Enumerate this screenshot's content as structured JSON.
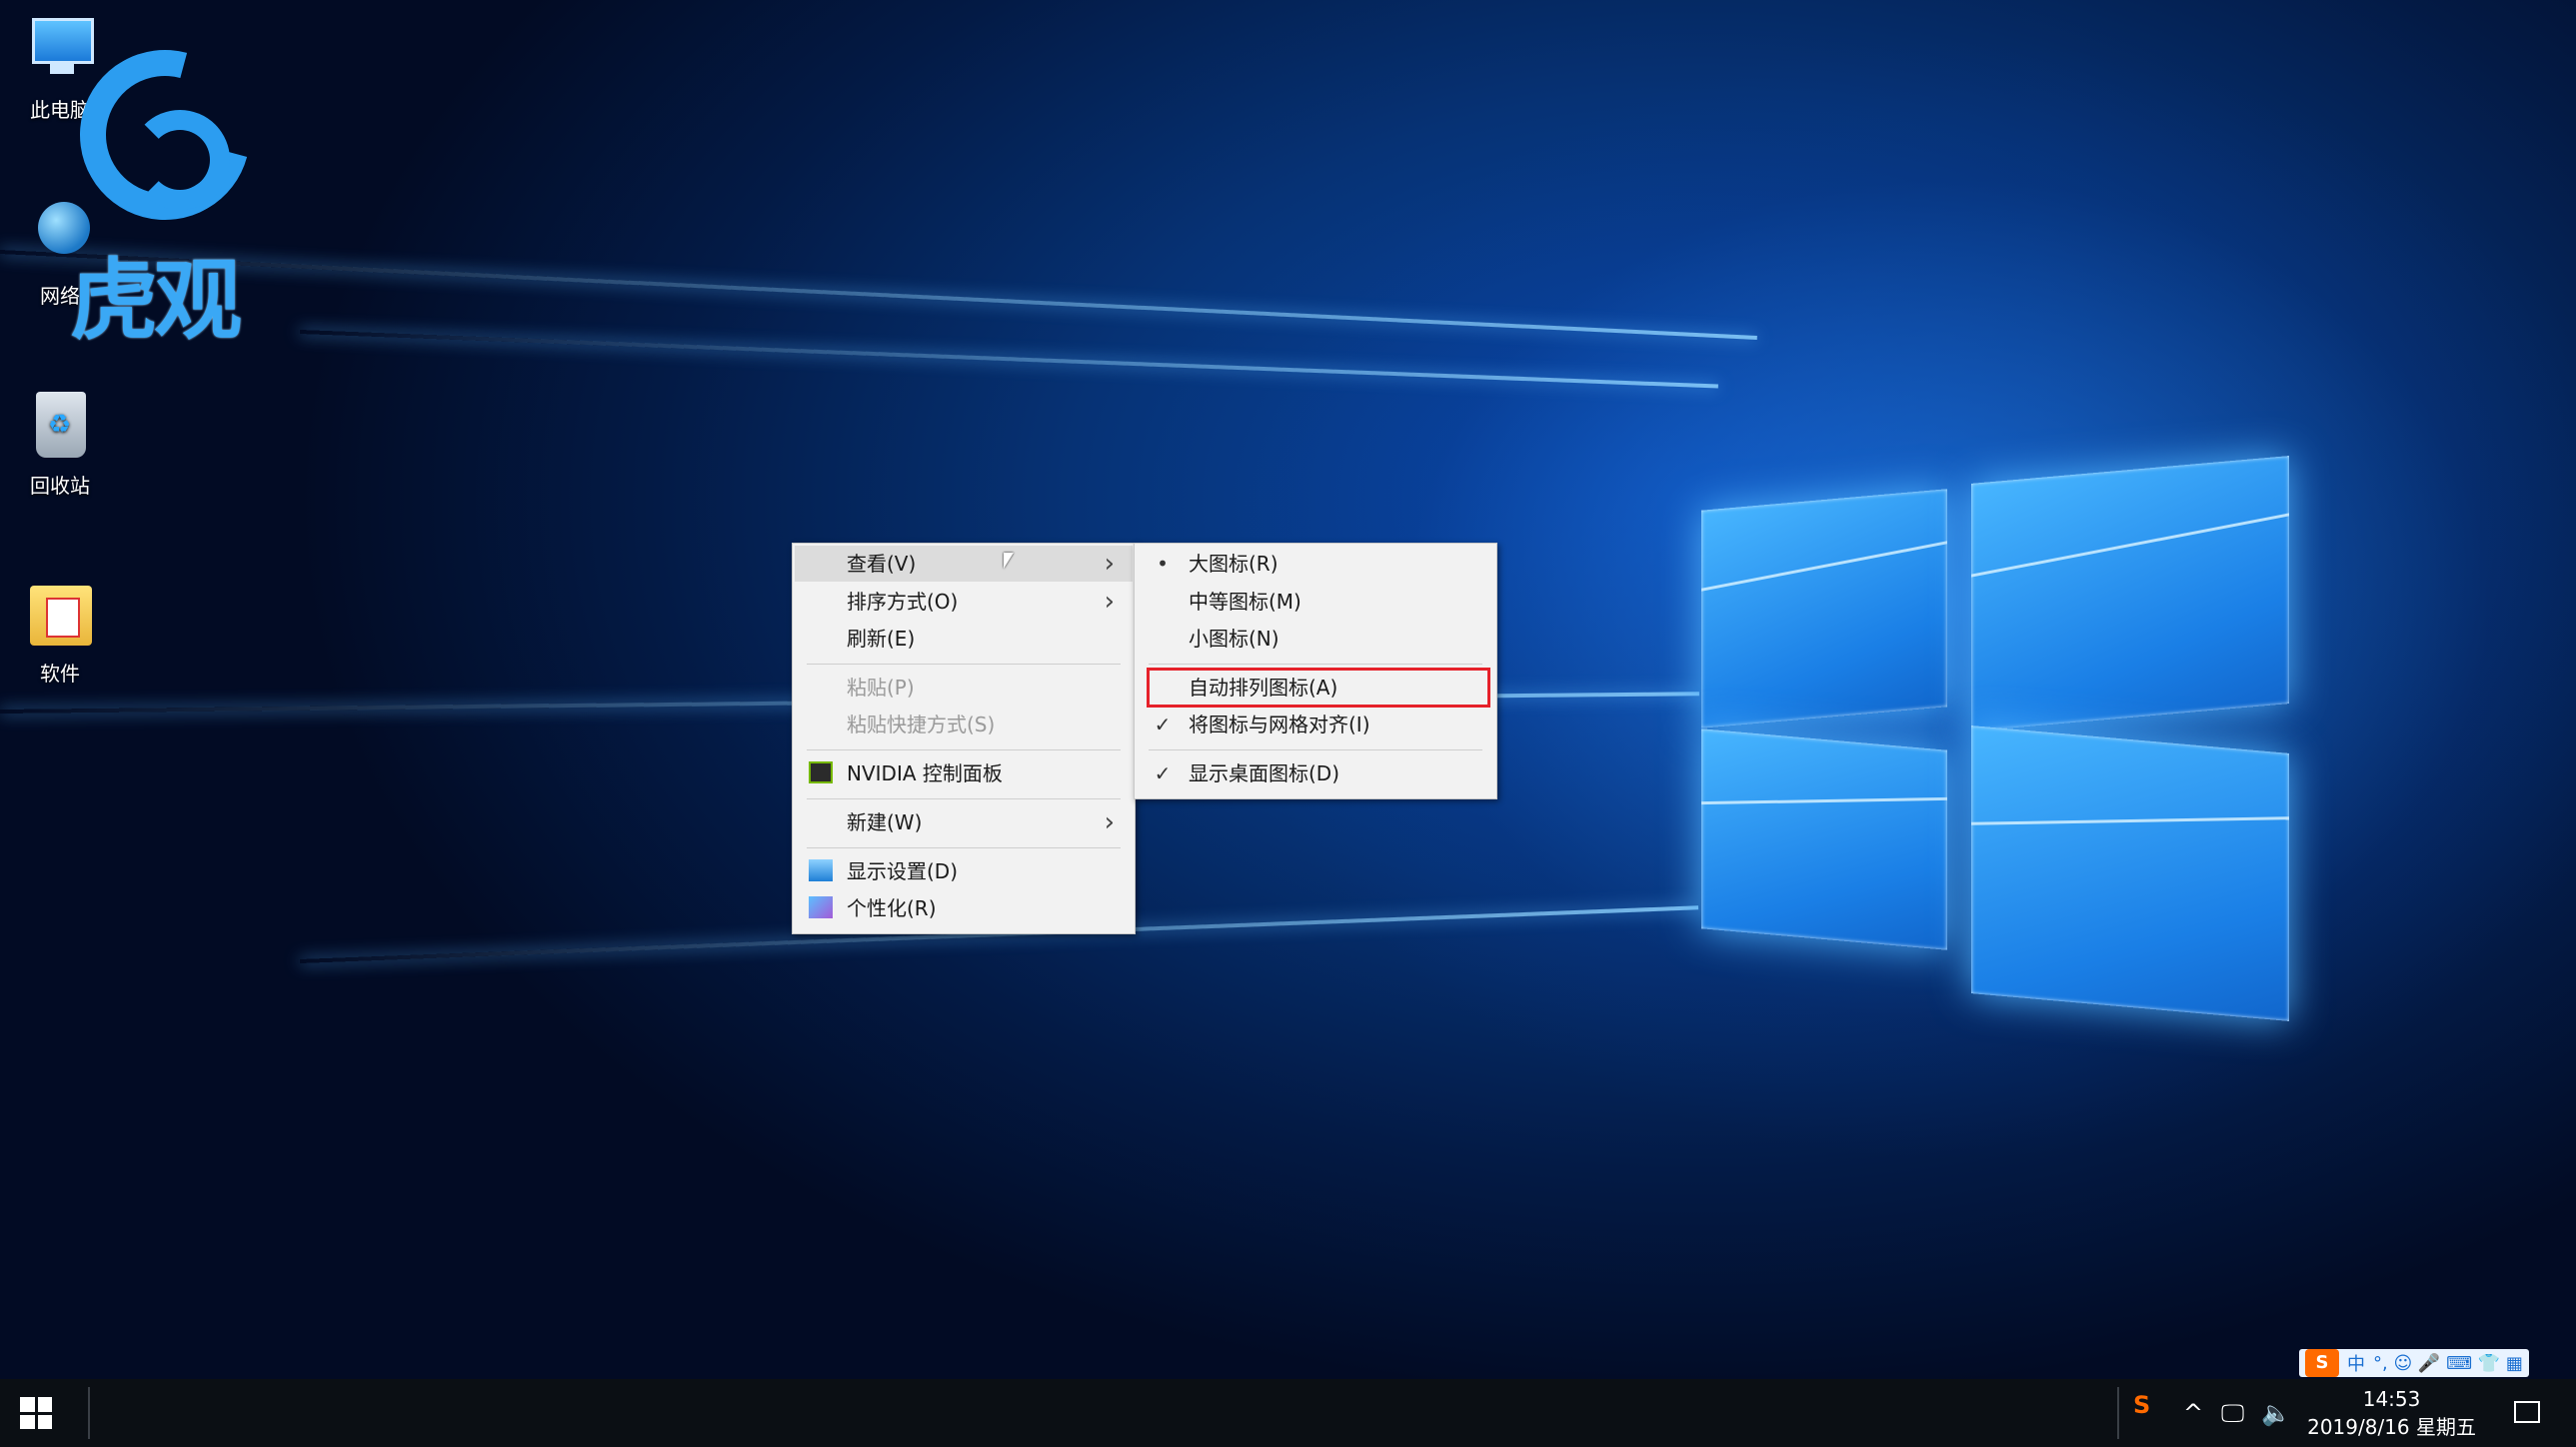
{
  "desktop": {
    "icons": [
      {
        "label": "此电脑",
        "icon": "computer-icon"
      },
      {
        "label": "网络",
        "icon": "network-icon"
      },
      {
        "label": "回收站",
        "icon": "recycle-bin-icon"
      },
      {
        "label": "软件",
        "icon": "folder-icon"
      }
    ],
    "watermark": {
      "text": "虎观",
      "icon": "huguan-logo"
    }
  },
  "context_menu": {
    "items": [
      {
        "label": "查看(V)",
        "has_submenu": true,
        "highlighted": true
      },
      {
        "label": "排序方式(O)",
        "has_submenu": true
      },
      {
        "label": "刷新(E)"
      },
      {
        "label": "粘贴(P)",
        "disabled": true
      },
      {
        "label": "粘贴快捷方式(S)",
        "disabled": true
      },
      {
        "label": "NVIDIA 控制面板",
        "icon": "nvidia-icon"
      },
      {
        "label": "新建(W)",
        "has_submenu": true
      },
      {
        "label": "显示设置(D)",
        "icon": "display-settings-icon"
      },
      {
        "label": "个性化(R)",
        "icon": "personalize-icon"
      }
    ]
  },
  "view_submenu": {
    "items": [
      {
        "label": "大图标(R)",
        "mark": "•"
      },
      {
        "label": "中等图标(M)",
        "mark": ""
      },
      {
        "label": "小图标(N)",
        "mark": ""
      },
      {
        "label": "自动排列图标(A)",
        "mark": "",
        "outlined": true
      },
      {
        "label": "将图标与网格对齐(I)",
        "mark": "✓"
      },
      {
        "label": "显示桌面图标(D)",
        "mark": "✓"
      }
    ],
    "outline_color": "#e6212a"
  },
  "taskbar": {
    "clock_time": "14:53",
    "clock_date": "2019/8/16 星期五",
    "ime": {
      "logo": "S",
      "mode": "中",
      "extras": "°, ☺ 🎤 ⌨ 👕 ▦"
    },
    "tray_icons": [
      "sogou-icon",
      "chevron-up-icon",
      "network-icon",
      "volume-icon"
    ],
    "tray_glyphs": {
      "sogou": "S",
      "chevron": "^",
      "network": "🖵",
      "volume": "🔈"
    }
  },
  "colors": {
    "accent": "#0a4bb0",
    "menu_bg": "#f2f2f2",
    "highlight": "#dcdcdc"
  }
}
